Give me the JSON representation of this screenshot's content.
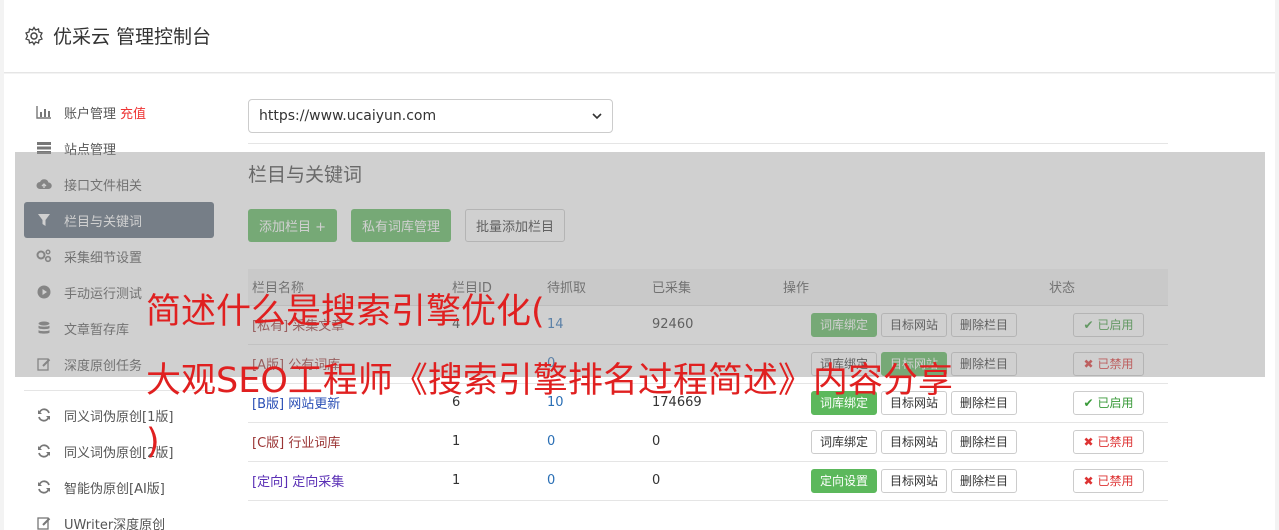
{
  "header": {
    "icon": "gear-icon",
    "title": "优采云 管理控制台"
  },
  "sidebar": {
    "items": [
      {
        "icon": "bar-chart-icon",
        "label": "账户管理",
        "extra": "充值"
      },
      {
        "icon": "server-icon",
        "label": "站点管理"
      },
      {
        "icon": "cloud-upload-icon",
        "label": "接口文件相关"
      },
      {
        "icon": "filter-icon",
        "label": "栏目与关键词",
        "active": true
      },
      {
        "icon": "cogs-icon",
        "label": "采集细节设置"
      },
      {
        "icon": "play-circle-icon",
        "label": "手动运行测试"
      },
      {
        "icon": "database-icon",
        "label": "文章暂存库"
      },
      {
        "icon": "edit-icon",
        "label": "深度原创任务"
      }
    ],
    "items2": [
      {
        "icon": "refresh-icon",
        "label": "同义词伪原创[1版]"
      },
      {
        "icon": "refresh-icon",
        "label": "同义词伪原创[2版]"
      },
      {
        "icon": "refresh-icon",
        "label": "智能伪原创[AI版]"
      },
      {
        "icon": "edit-icon",
        "label": "UWriter深度原创"
      }
    ]
  },
  "main": {
    "site_select": "https://www.ucaiyun.com",
    "section_title": "栏目与关键词",
    "buttons": {
      "add": "添加栏目 +",
      "private_lib": "私有词库管理",
      "batch_add": "批量添加栏目"
    },
    "table": {
      "headers": [
        "栏目名称",
        "栏目ID",
        "待抓取",
        "已采集",
        "操作",
        "状态"
      ],
      "rows": [
        {
          "tag": "[私有]",
          "name": "采集文章",
          "id": "4",
          "pending": "14",
          "done": "92460",
          "op1": "词库绑定",
          "op2": "目标网站",
          "op3": "删除栏目",
          "status": "已启用",
          "status_on": true
        },
        {
          "tag": "[A版]",
          "name": "公有词库",
          "id": "",
          "pending": "0",
          "done": "",
          "op1": "词库绑定",
          "op2": "目标网站",
          "op3": "删除栏目",
          "status": "已禁用",
          "status_on": false
        },
        {
          "tag": "[B版]",
          "name": "网站更新",
          "id": "6",
          "pending": "10",
          "done": "174669",
          "op1": "词库绑定",
          "op2": "目标网站",
          "op3": "删除栏目",
          "status": "已启用",
          "status_on": true
        },
        {
          "tag": "[C版]",
          "name": "行业词库",
          "id": "1",
          "pending": "0",
          "done": "0",
          "op1": "词库绑定",
          "op2": "目标网站",
          "op3": "删除栏目",
          "status": "已禁用",
          "status_on": false
        },
        {
          "tag": "[定向]",
          "name": "定向采集",
          "id": "1",
          "pending": "0",
          "done": "0",
          "op1": "定向设置",
          "op2": "目标网站",
          "op3": "删除栏目",
          "status": "已禁用",
          "status_on": false
        }
      ]
    }
  },
  "overlay": {
    "line1": "简述什么是搜索引擎优化(",
    "line2": "大观SEO工程师《搜索引擎排名过程简述》内容分享",
    "line3": ")"
  }
}
